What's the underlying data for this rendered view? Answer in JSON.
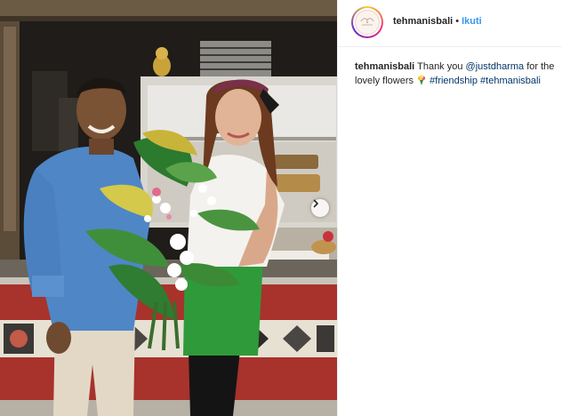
{
  "post": {
    "username": "tehmanisbali",
    "separator": "•",
    "follow_label": "Ikuti",
    "avatar_text": "Teh Manis"
  },
  "caption": {
    "username": "tehmanisbali",
    "text_before": "Thank you",
    "mention": "@justdharma",
    "text_middle": "for the lovely flowers",
    "emoji": "bouquet-emoji",
    "hashtag_1": "#friendship",
    "hashtag_2": "#tehmanisbali"
  },
  "photo": {
    "icon": "chevron-right-icon"
  },
  "colors": {
    "link_blue": "#3897f0",
    "hashtag_blue": "#003569",
    "text": "#262626",
    "wall_red": "#a8322c",
    "apron_green": "#2f9a3a"
  }
}
